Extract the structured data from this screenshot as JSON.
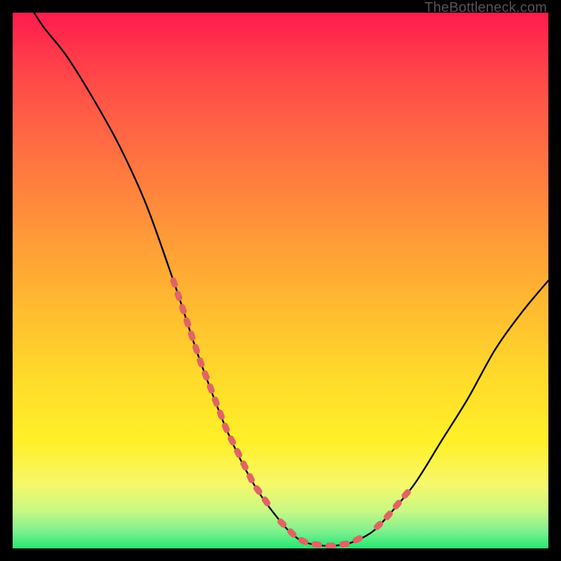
{
  "attribution": "TheBottleneck.com",
  "chart_data": {
    "type": "line",
    "title": "",
    "xlabel": "",
    "ylabel": "",
    "xlim": [
      0,
      100
    ],
    "ylim": [
      0,
      100
    ],
    "series": [
      {
        "name": "bottleneck-curve",
        "x": [
          4,
          6,
          10,
          15,
          20,
          25,
          30,
          32,
          35,
          40,
          45,
          50,
          53,
          55,
          58,
          60,
          63,
          67,
          70,
          75,
          80,
          85,
          90,
          95,
          100
        ],
        "y": [
          100,
          97,
          92,
          84,
          75,
          64,
          50,
          44,
          35,
          22,
          12,
          5,
          2,
          1,
          0.5,
          0.5,
          1,
          3,
          6,
          12,
          20,
          28,
          37,
          44,
          50
        ],
        "color": "#000000"
      }
    ],
    "highlight_segments": [
      {
        "name": "left-shoulder-dashes",
        "color": "#e06464",
        "x_range": [
          30,
          48
        ],
        "description": "thick dashed overlay on descending limb near bottom"
      },
      {
        "name": "valley-dashes",
        "color": "#e06464",
        "x_range": [
          50,
          66
        ],
        "description": "thick dashed overlay across the valley floor"
      },
      {
        "name": "right-shoulder-dashes",
        "color": "#e06464",
        "x_range": [
          68,
          74
        ],
        "description": "thick dashed overlay on ascending limb near bottom"
      }
    ],
    "background": {
      "type": "vertical-gradient",
      "stops": [
        {
          "pct": 0,
          "color": "#ff1a4d"
        },
        {
          "pct": 30,
          "color": "#ff7a3f"
        },
        {
          "pct": 68,
          "color": "#ffda2a"
        },
        {
          "pct": 88,
          "color": "#f7f86a"
        },
        {
          "pct": 100,
          "color": "#20e870"
        }
      ]
    }
  }
}
